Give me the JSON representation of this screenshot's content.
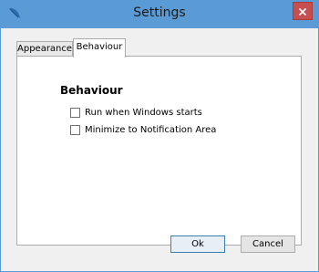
{
  "window": {
    "title": "Settings",
    "accent_color": "#5a9bd5",
    "close_color": "#c74f4f"
  },
  "tabs": [
    {
      "label": "Appearance",
      "active": false
    },
    {
      "label": "Behaviour",
      "active": true
    }
  ],
  "behaviour": {
    "heading": "Behaviour",
    "options": [
      {
        "label": "Run when Windows  starts",
        "checked": false
      },
      {
        "label": "Minimize to Notification Area",
        "checked": false
      }
    ]
  },
  "buttons": {
    "ok_label": "Ok",
    "cancel_label": "Cancel"
  },
  "icons": {
    "app": "feather-icon",
    "close": "close-icon"
  }
}
